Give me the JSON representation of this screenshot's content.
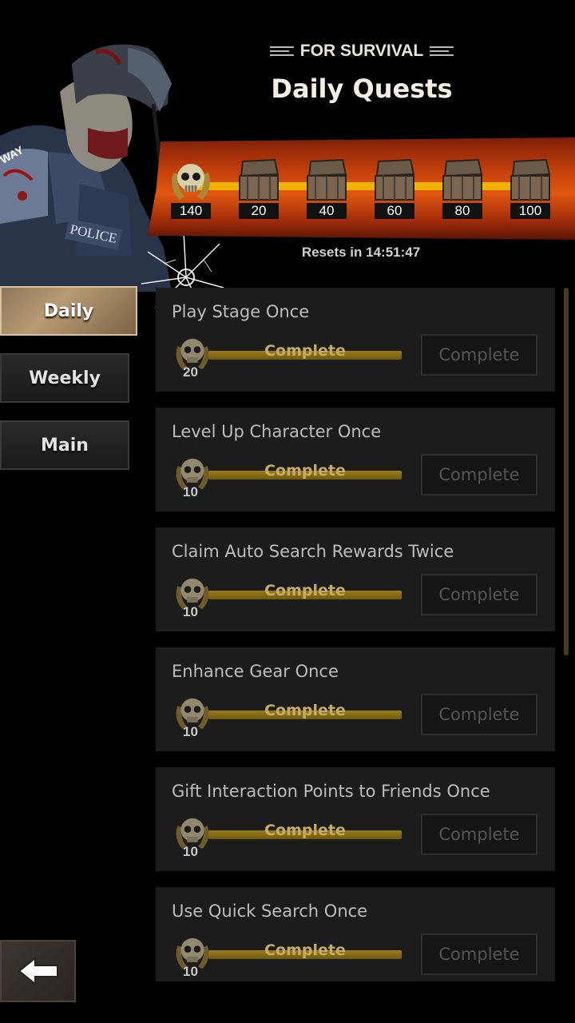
{
  "header": {
    "subtitle": "FOR SURVIVAL",
    "title": "Daily Quests"
  },
  "progress": {
    "current_points": "140",
    "milestones": [
      "20",
      "40",
      "60",
      "80",
      "100"
    ],
    "resets_text": "Resets in 14:51:47"
  },
  "tabs": [
    {
      "label": "Daily",
      "active": true
    },
    {
      "label": "Weekly",
      "active": false
    },
    {
      "label": "Main",
      "active": false
    }
  ],
  "quests": [
    {
      "name": "Play Stage Once",
      "reward": "20",
      "bar_text": "Complete",
      "button": "Complete"
    },
    {
      "name": "Level Up Character Once",
      "reward": "10",
      "bar_text": "Complete",
      "button": "Complete"
    },
    {
      "name": "Claim Auto Search Rewards Twice",
      "reward": "10",
      "bar_text": "Complete",
      "button": "Complete"
    },
    {
      "name": "Enhance Gear Once",
      "reward": "10",
      "bar_text": "Complete",
      "button": "Complete"
    },
    {
      "name": "Gift Interaction Points to Friends Once",
      "reward": "10",
      "bar_text": "Complete",
      "button": "Complete"
    },
    {
      "name": "Use Quick Search Once",
      "reward": "10",
      "bar_text": "Complete",
      "button": "Complete"
    }
  ],
  "character_art": {
    "badge_text": "POLICE",
    "shoulder_text": "WAY"
  },
  "colors": {
    "band": "#c9420d",
    "track": "#f0b400",
    "quest_bg": "#1c1c1c",
    "tab_active": "#b89b74"
  },
  "icons": [
    "skull-medal-icon",
    "chest-icon",
    "back-arrow-icon"
  ]
}
